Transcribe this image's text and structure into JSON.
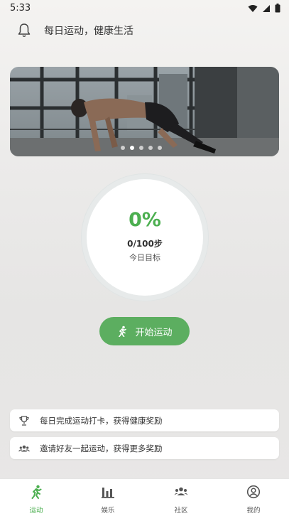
{
  "status_bar": {
    "time": "5:33",
    "icons": [
      "wifi-icon",
      "signal-icon",
      "battery-icon"
    ]
  },
  "header": {
    "icon": "bell-icon",
    "title": "每日运动，健康生活"
  },
  "banner": {
    "image": "man-doing-exercise-photo",
    "total_slides": 5,
    "active_slide": 2
  },
  "progress": {
    "percent_label": "0%",
    "steps_label": "0/100步",
    "goal_label": "今日目标",
    "value": 0
  },
  "start_button": {
    "icon": "running-icon",
    "label": "开始运动"
  },
  "tips": [
    {
      "icon": "trophy-icon",
      "text": "每日完成运动打卡，获得健康奖励"
    },
    {
      "icon": "friends-icon",
      "text": "邀请好友一起运动，获得更多奖励"
    }
  ],
  "tabbar": {
    "tabs": [
      {
        "icon": "running-icon",
        "label": "运动",
        "active": true
      },
      {
        "icon": "bar-chart-icon",
        "label": "娱乐",
        "active": false
      },
      {
        "icon": "community-icon",
        "label": "社区",
        "active": false
      },
      {
        "icon": "profile-icon",
        "label": "我的",
        "active": false
      }
    ]
  },
  "colors": {
    "accent": "#4caf50",
    "button": "#5cae60"
  }
}
